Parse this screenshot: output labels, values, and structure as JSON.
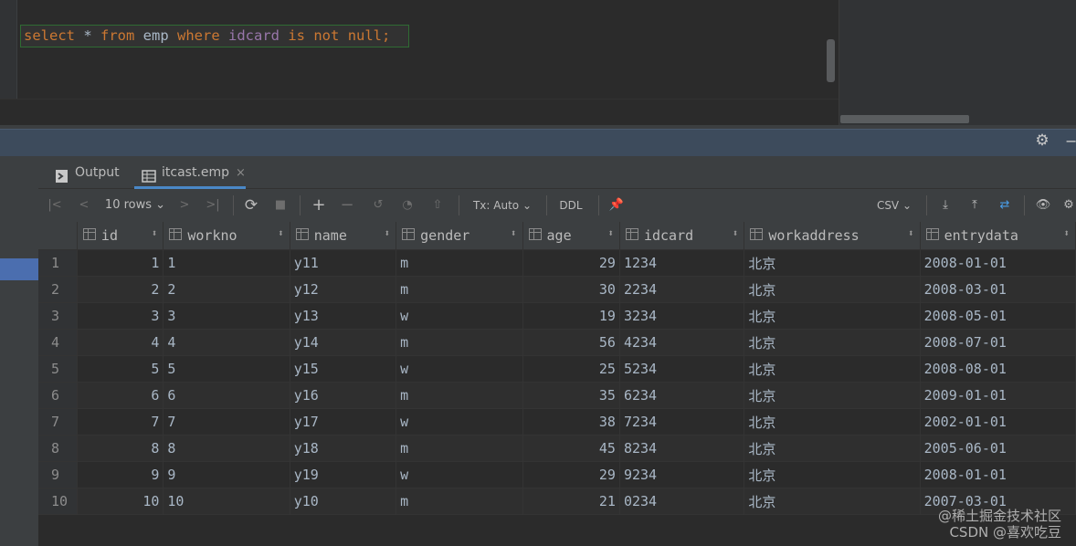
{
  "editor": {
    "tokens": [
      {
        "text": "select",
        "cls": "kw"
      },
      {
        "text": " * ",
        "cls": "ident"
      },
      {
        "text": "from",
        "cls": "kw"
      },
      {
        "text": " emp ",
        "cls": "ident"
      },
      {
        "text": "where",
        "cls": "kw"
      },
      {
        "text": " idcard ",
        "cls": "col"
      },
      {
        "text": "is",
        "cls": "kw"
      },
      {
        "text": " ",
        "cls": "ident"
      },
      {
        "text": "not",
        "cls": "kw"
      },
      {
        "text": " ",
        "cls": "ident"
      },
      {
        "text": "null",
        "cls": "kw"
      },
      {
        "text": ";",
        "cls": "punc"
      }
    ]
  },
  "tabs": [
    {
      "label": "Output",
      "icon": "output-icon"
    },
    {
      "label": "itcast.emp",
      "icon": "table-icon",
      "close": "×"
    }
  ],
  "toolbar": {
    "rows_label": "10 rows",
    "tx_label": "Tx: Auto",
    "ddl_label": "DDL",
    "csv_label": "CSV"
  },
  "table": {
    "columns": [
      "id",
      "workno",
      "name",
      "gender",
      "age",
      "idcard",
      "workaddress",
      "entrydata"
    ],
    "rows": [
      [
        "1",
        "1",
        "1",
        "y11",
        "m",
        "29",
        "1234",
        "北京",
        "2008-01-01"
      ],
      [
        "2",
        "2",
        "2",
        "y12",
        "m",
        "30",
        "2234",
        "北京",
        "2008-03-01"
      ],
      [
        "3",
        "3",
        "3",
        "y13",
        "w",
        "19",
        "3234",
        "北京",
        "2008-05-01"
      ],
      [
        "4",
        "4",
        "4",
        "y14",
        "m",
        "56",
        "4234",
        "北京",
        "2008-07-01"
      ],
      [
        "5",
        "5",
        "5",
        "y15",
        "w",
        "25",
        "5234",
        "北京",
        "2008-08-01"
      ],
      [
        "6",
        "6",
        "6",
        "y16",
        "m",
        "35",
        "6234",
        "北京",
        "2009-01-01"
      ],
      [
        "7",
        "7",
        "7",
        "y17",
        "w",
        "38",
        "7234",
        "北京",
        "2002-01-01"
      ],
      [
        "8",
        "8",
        "8",
        "y18",
        "m",
        "45",
        "8234",
        "北京",
        "2005-06-01"
      ],
      [
        "9",
        "9",
        "9",
        "y19",
        "w",
        "29",
        "9234",
        "北京",
        "2008-01-01"
      ],
      [
        "10",
        "10",
        "10",
        "y10",
        "m",
        "21",
        "0234",
        "北京",
        "2007-03-01"
      ]
    ]
  },
  "watermark": {
    "line1": "@稀土掘金技术社区",
    "line2": "CSDN @喜欢吃豆"
  },
  "colors": {
    "keyword": "#cc7832",
    "identifier": "#a9b7c6",
    "column": "#9876aa",
    "accent": "#4b6eaf"
  }
}
